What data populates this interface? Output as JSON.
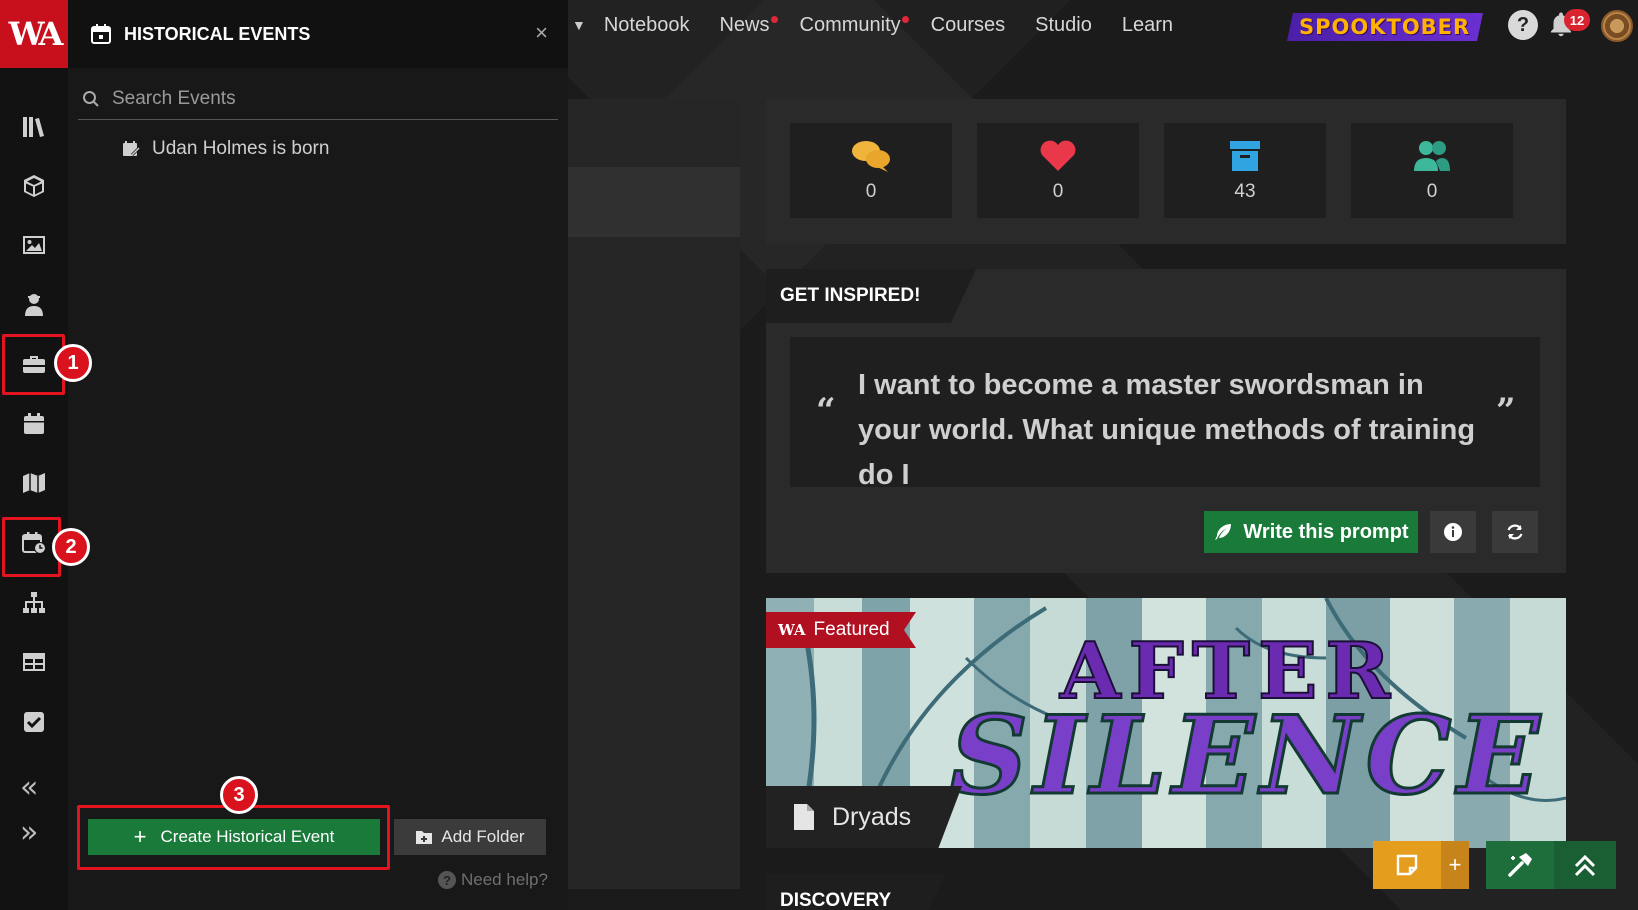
{
  "topnav": {
    "items": [
      {
        "label": "Notebook",
        "dot": false
      },
      {
        "label": "News",
        "dot": true
      },
      {
        "label": "Community",
        "dot": true
      },
      {
        "label": "Courses",
        "dot": false
      },
      {
        "label": "Studio",
        "dot": false
      },
      {
        "label": "Learn",
        "dot": false
      }
    ],
    "promo": "SPOOKTOBER",
    "help": "?",
    "notifications": "12"
  },
  "rail": {
    "logo": "WA",
    "icons": [
      "person-icon",
      "library-icon",
      "cube-icon",
      "image-icon",
      "character-icon",
      "toolbox-icon",
      "calendar-icon",
      "map-icon",
      "calendar-clock-icon",
      "hierarchy-icon",
      "table-icon",
      "checkbox-icon"
    ],
    "steps": [
      "1",
      "2",
      "3"
    ]
  },
  "panel": {
    "title": "HISTORICAL EVENTS",
    "close": "×",
    "search_placeholder": "Search Events",
    "events": [
      {
        "label": "Udan Holmes is born"
      }
    ],
    "create_label": "Create Historical Event",
    "create_icon": "+",
    "folder_label": "Add Folder",
    "help_label": "Need help?"
  },
  "stats": [
    {
      "icon": "comments-icon",
      "value": "0",
      "color": "#f0b43c"
    },
    {
      "icon": "heart-icon",
      "value": "0",
      "color": "#e8384a"
    },
    {
      "icon": "archive-icon",
      "value": "43",
      "color": "#2fa4e0"
    },
    {
      "icon": "users-icon",
      "value": "0",
      "color": "#3db89a"
    }
  ],
  "inspire": {
    "heading": "GET INSPIRED!",
    "open_quote": "“",
    "close_quote": "”",
    "prompt": "I want to become a master swordsman in your world. What unique methods of training do I",
    "write_label": "Write this prompt"
  },
  "featured": {
    "ribbon": "Featured",
    "ribbon_logo": "WA",
    "art_line1": "AFTER",
    "art_line2": "SILENCE",
    "article": "Dryads"
  },
  "discovery": "DISCOVERY",
  "fab": {
    "note_plus": "+"
  },
  "colors": {
    "accent_red": "#c8101c",
    "green": "#1a7a3a",
    "highlight": "#e3141f"
  }
}
